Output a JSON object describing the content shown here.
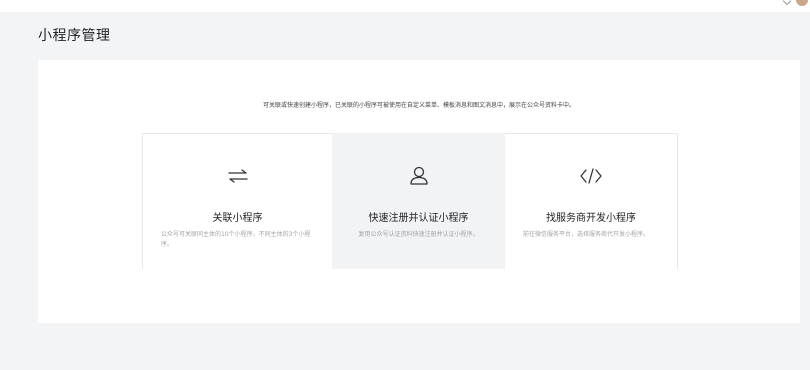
{
  "page": {
    "title": "小程序管理"
  },
  "panel": {
    "description": "可关联或快速创建小程序，已关联的小程序可被使用在自定义菜单、模板消息和图文消息中，展示在公众号资料卡中。"
  },
  "cards": [
    {
      "icon": "link-arrows-icon",
      "title": "关联小程序",
      "desc": "公众号可关联同主体的10个小程序，不同主体的3个小程序。"
    },
    {
      "icon": "user-icon",
      "title": "快速注册并认证小程序",
      "desc": "复用公众号认证资料快速注册并认证小程序。"
    },
    {
      "icon": "code-icon",
      "title": "找服务商开发小程序",
      "desc": "前往微信服务平台，选择服务商代开发小程序。"
    }
  ]
}
